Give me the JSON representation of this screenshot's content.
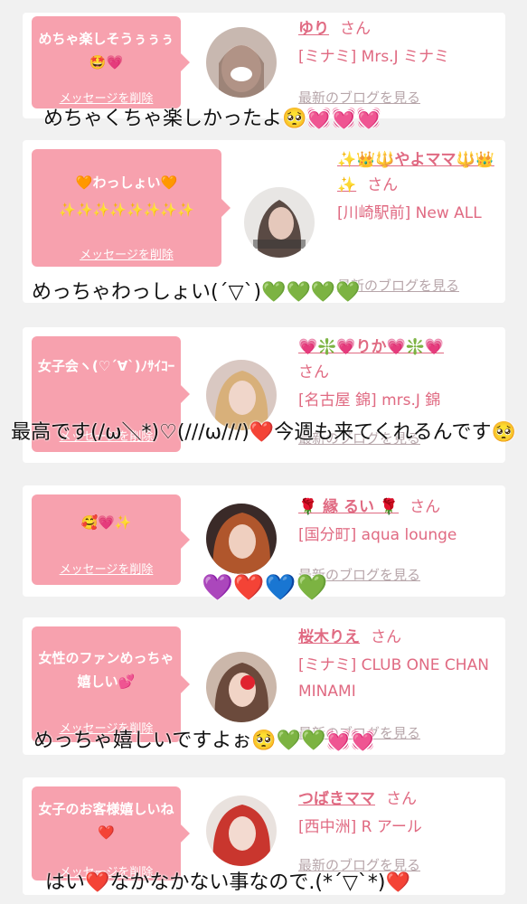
{
  "cards": [
    {
      "message": "めちゃ楽しそうぅぅぅ🤩💗",
      "delete_label": "メッセージを削除",
      "name": "ゆり",
      "san": "さん",
      "shop": "[ミナミ] Mrs.J ミナミ",
      "blog_label": "最新のブログを見る",
      "overlay": "めちゃくちゃ楽しかったよ🥺💓💓💓"
    },
    {
      "message": "🧡わっしょい🧡 ✨✨✨✨✨✨✨✨",
      "delete_label": "メッセージを削除",
      "name": "✨👑🔱やよママ🔱👑✨",
      "san": "さん",
      "shop": "[川崎駅前] New ALL",
      "blog_label": "最新のブログを見る",
      "overlay": "めっちゃわっしょい(´▽`)💚💚💚💚"
    },
    {
      "message": "女子会ヽ(♡´∀`)ﾉｻｲｺｰ",
      "delete_label": "メッセージを削除",
      "name": "💗❇️💗りか💗❇️💗",
      "san": "さん",
      "shop": "[名古屋 錦] mrs.J 錦",
      "blog_label": "最新のブログを見る",
      "overlay": "最高です(/ω＼*)♡(///ω///)❤️今週も来てくれるんです🥺"
    },
    {
      "message": "🥰💗✨",
      "delete_label": "メッセージを削除",
      "name": "🌹 縁 るい 🌹",
      "san": "さん",
      "shop": "[国分町] aqua lounge",
      "blog_label": "最新のブログを見る",
      "overlay": "💜❤️💙💚"
    },
    {
      "message": "女性のファンめっちゃ嬉しい💕",
      "delete_label": "メッセージを削除",
      "name": "桜木りえ",
      "san": "さん",
      "shop": "[ミナミ] CLUB ONE CHAN MINAMI",
      "blog_label": "最新のブログを見る",
      "overlay": "めっちゃ嬉しいですよぉ🥺💚💚💓💓"
    },
    {
      "message": "女子のお客様嬉しいね❤️",
      "delete_label": "メッセージを削除",
      "name": "つばきママ",
      "san": "さん",
      "shop": "[西中洲] R アール",
      "blog_label": "最新のブログを見る",
      "overlay": "はい❤️なかなかない事なので.(*´▽`*)❤️"
    }
  ],
  "colors": {
    "bubble": "#f7a1ae",
    "name": "#e06a82",
    "blog": "#b7a6aa",
    "background": "#f1f1f1"
  },
  "icons": [
    "avatar-photo"
  ]
}
